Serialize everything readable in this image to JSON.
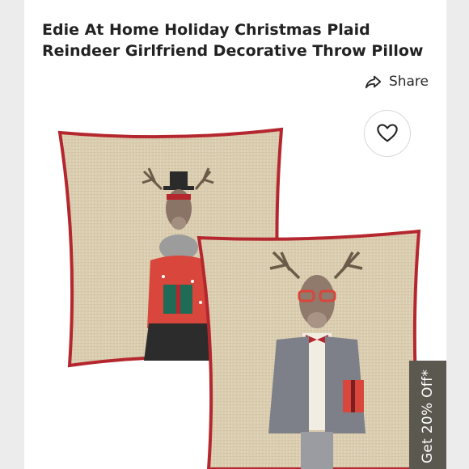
{
  "product": {
    "title": "Edie At Home Holiday Christmas Plaid Reindeer Girlfriend Decorative Throw Pillow"
  },
  "share": {
    "label": "Share",
    "icon": "share-arrow-icon"
  },
  "image": {
    "like_icon": "heart-icon",
    "colors": {
      "linen": "#d9ccae",
      "piping": "#b5272e",
      "sweater": "#d9463c",
      "blazer": "#7d8088"
    }
  },
  "promo": {
    "label": "Get 20% Off*"
  }
}
